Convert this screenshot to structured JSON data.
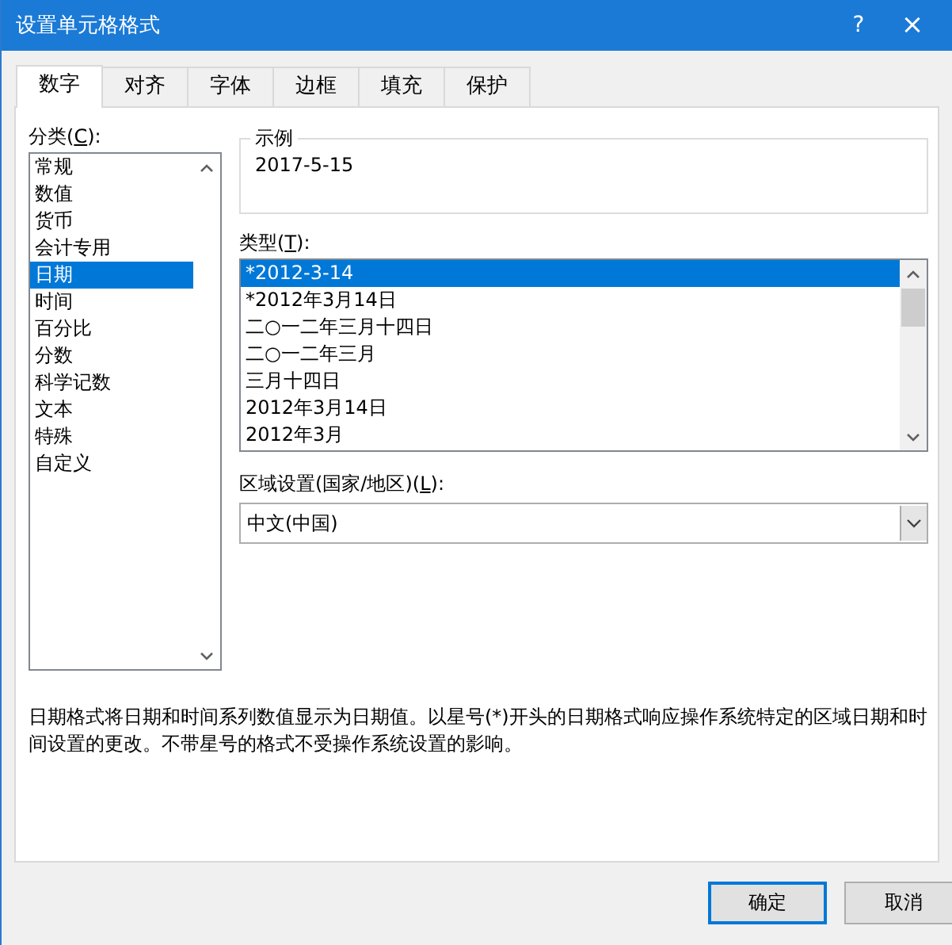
{
  "window": {
    "title": "设置单元格格式",
    "help": "?",
    "close": "×"
  },
  "tabs": [
    {
      "label": "数字",
      "selected": true
    },
    {
      "label": "对齐",
      "selected": false
    },
    {
      "label": "字体",
      "selected": false
    },
    {
      "label": "边框",
      "selected": false
    },
    {
      "label": "填充",
      "selected": false
    },
    {
      "label": "保护",
      "selected": false
    }
  ],
  "category": {
    "label": "分类(**C**):",
    "items": [
      {
        "label": "常规",
        "selected": false
      },
      {
        "label": "数值",
        "selected": false
      },
      {
        "label": "货币",
        "selected": false
      },
      {
        "label": "会计专用",
        "selected": false
      },
      {
        "label": "日期",
        "selected": true
      },
      {
        "label": "时间",
        "selected": false
      },
      {
        "label": "百分比",
        "selected": false
      },
      {
        "label": "分数",
        "selected": false
      },
      {
        "label": "科学记数",
        "selected": false
      },
      {
        "label": "文本",
        "selected": false
      },
      {
        "label": "特殊",
        "selected": false
      },
      {
        "label": "自定义",
        "selected": false
      }
    ]
  },
  "sample": {
    "label": "示例",
    "value": "2017-5-15"
  },
  "type": {
    "label": "类型(**T**):",
    "items": [
      {
        "label": "*2012-3-14",
        "selected": true
      },
      {
        "label": "*2012年3月14日",
        "selected": false
      },
      {
        "label": "二○一二年三月十四日",
        "selected": false
      },
      {
        "label": "二○一二年三月",
        "selected": false
      },
      {
        "label": "三月十四日",
        "selected": false
      },
      {
        "label": "2012年3月14日",
        "selected": false
      },
      {
        "label": "2012年3月",
        "selected": false
      }
    ]
  },
  "locale": {
    "label": "区域设置(国家/地区)(**L**):",
    "value": "中文(中国)"
  },
  "description": "日期格式将日期和时间系列数值显示为日期值。以星号(*)开头的日期格式响应操作系统特定的区域日期和时间设置的更改。不带星号的格式不受操作系统设置的影响。",
  "buttons": [
    {
      "label": "确定",
      "default": true
    },
    {
      "label": "取消",
      "default": false
    }
  ]
}
